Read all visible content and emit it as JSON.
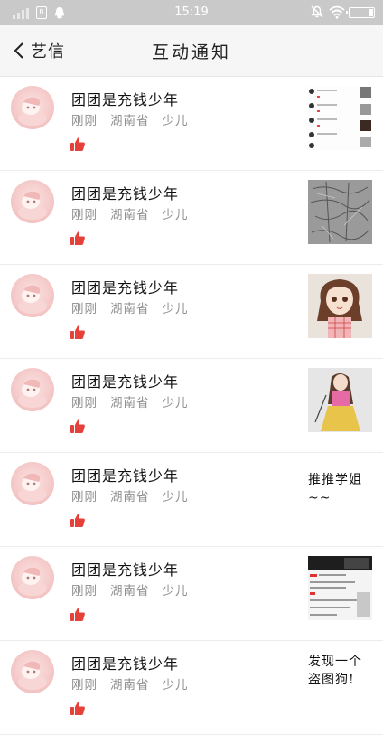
{
  "status_bar": {
    "time": "15:19",
    "box_icon_text": "B",
    "battery_level": 0.15
  },
  "header": {
    "back_label": "艺信",
    "title": "互动通知"
  },
  "notifications": [
    {
      "name": "团团是充钱少年",
      "time": "刚刚",
      "region": "湖南省",
      "user_type": "少儿",
      "action": "like-icon",
      "preview": "screenshot-list"
    },
    {
      "name": "团团是充钱少年",
      "time": "刚刚",
      "region": "湖南省",
      "user_type": "少儿",
      "action": "like-icon",
      "preview": "pencil-sketch"
    },
    {
      "name": "团团是充钱少年",
      "time": "刚刚",
      "region": "湖南省",
      "user_type": "少儿",
      "action": "like-icon",
      "preview": "girl-drawing-dress"
    },
    {
      "name": "团团是充钱少年",
      "time": "刚刚",
      "region": "湖南省",
      "user_type": "少儿",
      "action": "like-icon",
      "preview": "girl-drawing-pink"
    },
    {
      "name": "团团是充钱少年",
      "time": "刚刚",
      "region": "湖南省",
      "user_type": "少儿",
      "action": "like-icon",
      "comment": "推推学姐~~"
    },
    {
      "name": "团团是充钱少年",
      "time": "刚刚",
      "region": "湖南省",
      "user_type": "少儿",
      "action": "like-icon",
      "preview": "screenshot-dark"
    },
    {
      "name": "团团是充钱少年",
      "time": "刚刚",
      "region": "湖南省",
      "user_type": "少儿",
      "action": "like-icon",
      "comment": "发现一个盗图狗!"
    }
  ],
  "colors": {
    "status_bar": "#c9c9c9",
    "header_bg": "#f6f6f6",
    "like": "#e5413a",
    "meta_text": "#8f8f8f"
  }
}
